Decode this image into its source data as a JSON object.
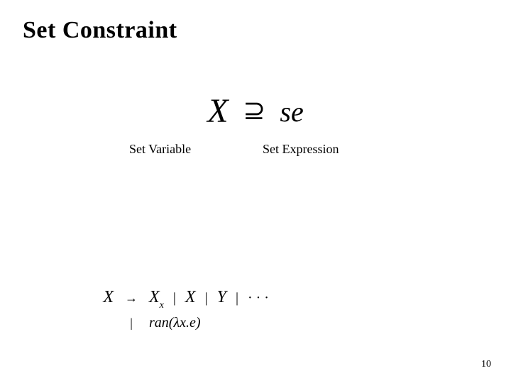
{
  "title": "Set Constraint",
  "main_formula": {
    "lhs": "X",
    "relation": "⊇",
    "rhs": "se"
  },
  "labels": {
    "left": "Set Variable",
    "right": "Set Expression"
  },
  "grammar": {
    "lhs": "X",
    "arrow": "→",
    "line1_parts": {
      "xx": "X",
      "xx_sub": "x",
      "x": "X",
      "y": "Y",
      "dots": "· · ·"
    },
    "line2_sep": "|",
    "line2": "ran(λx.e)"
  },
  "page_number": "10"
}
